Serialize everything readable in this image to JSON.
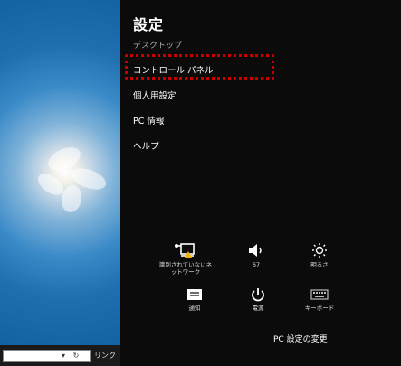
{
  "desktop": {
    "taskbar": {
      "address_value": "",
      "link_label": "リンク"
    }
  },
  "charm": {
    "title": "設定",
    "subtitle": "デスクトップ",
    "items": [
      {
        "label": "コントロール パネル",
        "highlighted": true
      },
      {
        "label": "個人用設定"
      },
      {
        "label": "PC 情報"
      },
      {
        "label": "ヘルプ"
      }
    ],
    "highlight_color": "#c80000",
    "quick_settings": [
      {
        "icon": "network-warning-icon",
        "label": "識別されていないネットワーク"
      },
      {
        "icon": "volume-icon",
        "label": "67"
      },
      {
        "icon": "brightness-icon",
        "label": "明るさ"
      },
      {
        "icon": "notifications-icon",
        "label": "通知"
      },
      {
        "icon": "power-icon",
        "label": "電源"
      },
      {
        "icon": "keyboard-icon",
        "label": "キーボード"
      }
    ],
    "footer_link": "PC 設定の変更"
  }
}
